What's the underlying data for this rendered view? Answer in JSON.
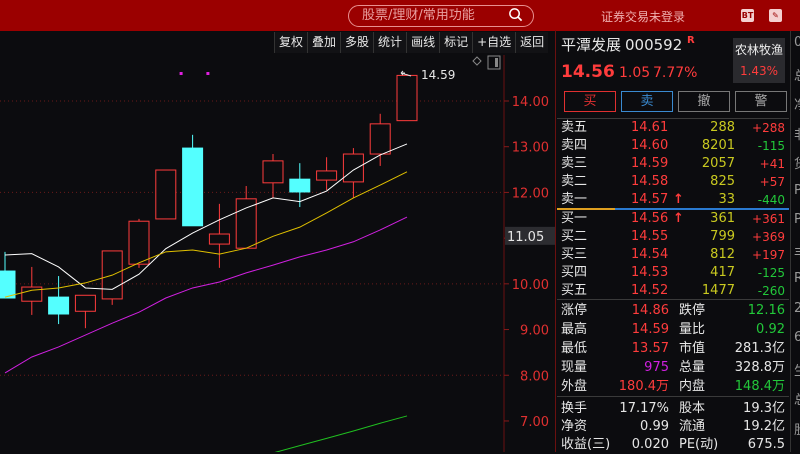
{
  "topbar": {
    "search_placeholder": "股票/理财/常用功能",
    "login_status": "证券交易未登录",
    "icon1": "BT",
    "icon2": "edit-icon"
  },
  "toolbar": [
    "复权",
    "叠加",
    "多股",
    "统计",
    "画线",
    "标记",
    "+自选",
    "返回"
  ],
  "stock": {
    "name": "平潭发展",
    "code": "000592",
    "badge": "R",
    "price": "14.56",
    "change": "1.05",
    "change_pct": "7.77%",
    "sector": "农林牧渔",
    "sector_pct": "1.43%"
  },
  "actions": {
    "buy": "买",
    "sell": "卖",
    "cancel": "撤",
    "alert": "警"
  },
  "asks": [
    {
      "label": "卖五",
      "price": "14.61",
      "vol": "288",
      "delta": "+288",
      "arrow": ""
    },
    {
      "label": "卖四",
      "price": "14.60",
      "vol": "8201",
      "delta": "-115",
      "arrow": ""
    },
    {
      "label": "卖三",
      "price": "14.59",
      "vol": "2057",
      "delta": "+41",
      "arrow": ""
    },
    {
      "label": "卖二",
      "price": "14.58",
      "vol": "825",
      "delta": "+57",
      "arrow": ""
    },
    {
      "label": "卖一",
      "price": "14.57",
      "vol": "33",
      "delta": "-440",
      "arrow": "↑"
    }
  ],
  "bids": [
    {
      "label": "买一",
      "price": "14.56",
      "vol": "361",
      "delta": "+361",
      "arrow": "↑"
    },
    {
      "label": "买二",
      "price": "14.55",
      "vol": "799",
      "delta": "+369",
      "arrow": ""
    },
    {
      "label": "买三",
      "price": "14.54",
      "vol": "812",
      "delta": "+197",
      "arrow": ""
    },
    {
      "label": "买四",
      "price": "14.53",
      "vol": "417",
      "delta": "-125",
      "arrow": ""
    },
    {
      "label": "买五",
      "price": "14.52",
      "vol": "1477",
      "delta": "-260",
      "arrow": ""
    }
  ],
  "stats": [
    {
      "l1": "涨停",
      "v1": "14.86",
      "c1": "red",
      "l2": "跌停",
      "v2": "12.16",
      "c2": "grn"
    },
    {
      "l1": "最高",
      "v1": "14.59",
      "c1": "red",
      "l2": "量比",
      "v2": "0.92",
      "c2": "grn"
    },
    {
      "l1": "最低",
      "v1": "13.57",
      "c1": "red",
      "l2": "市值",
      "v2": "281.3亿",
      "c2": "wht"
    },
    {
      "l1": "现量",
      "v1": "975",
      "c1": "mag",
      "l2": "总量",
      "v2": "328.8万",
      "c2": "wht"
    },
    {
      "l1": "外盘",
      "v1": "180.4万",
      "c1": "red",
      "l2": "内盘",
      "v2": "148.4万",
      "c2": "grn"
    }
  ],
  "fundamentals": [
    {
      "l1": "换手",
      "v1": "17.17%",
      "l2": "股本",
      "v2": "19.3亿"
    },
    {
      "l1": "净资",
      "v1": "0.99",
      "l2": "流通",
      "v2": "19.2亿"
    },
    {
      "l1": "收益(三)",
      "v1": "0.020",
      "l2": "PE(动)",
      "v2": "675.5"
    }
  ],
  "edge_chars": [
    "0",
    "总",
    "净",
    "非",
    "货",
    "P",
    "P",
    "丰",
    "R",
    "2",
    "6",
    "生",
    "总",
    "股"
  ],
  "colors": {
    "up": "#ff3c3c",
    "down": "#54ffff",
    "ma5": "#ffffff",
    "ma10": "#e0c000",
    "ma20": "#d020e0",
    "ma60": "#20c020"
  },
  "chart_data": {
    "type": "candlestick",
    "y_ticks": [
      "14.00",
      "13.00",
      "12.00",
      "11.00",
      "10.00",
      "9.00",
      "8.00",
      "7.00"
    ],
    "ylim": [
      6.3,
      14.95
    ],
    "high_label": "14.59",
    "cursor_price": "11.05",
    "candles": [
      {
        "o": 10.28,
        "h": 10.7,
        "l": 9.69,
        "c": 9.69
      },
      {
        "o": 9.62,
        "h": 10.37,
        "l": 9.32,
        "c": 9.93
      },
      {
        "o": 9.71,
        "h": 10.17,
        "l": 9.12,
        "c": 9.34
      },
      {
        "o": 9.4,
        "h": 9.75,
        "l": 9.03,
        "c": 9.75
      },
      {
        "o": 9.67,
        "h": 10.72,
        "l": 9.54,
        "c": 10.72
      },
      {
        "o": 10.43,
        "h": 11.42,
        "l": 10.35,
        "c": 11.37
      },
      {
        "o": 11.42,
        "h": 12.49,
        "l": 11.42,
        "c": 12.49
      },
      {
        "o": 12.97,
        "h": 13.26,
        "l": 11.27,
        "c": 11.27
      },
      {
        "o": 10.87,
        "h": 11.75,
        "l": 10.35,
        "c": 11.09
      },
      {
        "o": 10.78,
        "h": 12.14,
        "l": 10.78,
        "c": 11.86
      },
      {
        "o": 12.21,
        "h": 12.84,
        "l": 11.88,
        "c": 12.69
      },
      {
        "o": 12.29,
        "h": 12.64,
        "l": 11.68,
        "c": 12.01
      },
      {
        "o": 12.27,
        "h": 12.77,
        "l": 12.05,
        "c": 12.47
      },
      {
        "o": 12.23,
        "h": 12.97,
        "l": 11.88,
        "c": 12.84
      },
      {
        "o": 12.84,
        "h": 13.72,
        "l": 12.58,
        "c": 13.5
      },
      {
        "o": 13.57,
        "h": 14.59,
        "l": 13.57,
        "c": 14.56
      }
    ],
    "ma": [
      {
        "name": "MA5",
        "values": [
          10.63,
          10.66,
          10.37,
          9.91,
          9.88,
          10.21,
          10.77,
          11.11,
          11.4,
          11.66,
          11.88,
          11.8,
          12.03,
          12.49,
          12.82,
          13.06
        ]
      },
      {
        "name": "MA10",
        "values": [
          9.71,
          9.86,
          9.91,
          10.02,
          10.19,
          10.46,
          10.7,
          10.74,
          10.65,
          10.78,
          11.04,
          11.24,
          11.55,
          11.88,
          12.16,
          12.45
        ]
      },
      {
        "name": "MA20",
        "values": [
          8.05,
          8.4,
          8.62,
          8.88,
          9.14,
          9.38,
          9.69,
          9.91,
          10.04,
          10.24,
          10.41,
          10.59,
          10.74,
          10.92,
          11.18,
          11.46
        ]
      },
      {
        "name": "MA60",
        "values": [
          null,
          null,
          null,
          null,
          null,
          null,
          null,
          null,
          null,
          null,
          6.3,
          6.46,
          6.62,
          6.78,
          6.95,
          7.11
        ]
      }
    ],
    "signal_marks": [
      7,
      8
    ]
  }
}
